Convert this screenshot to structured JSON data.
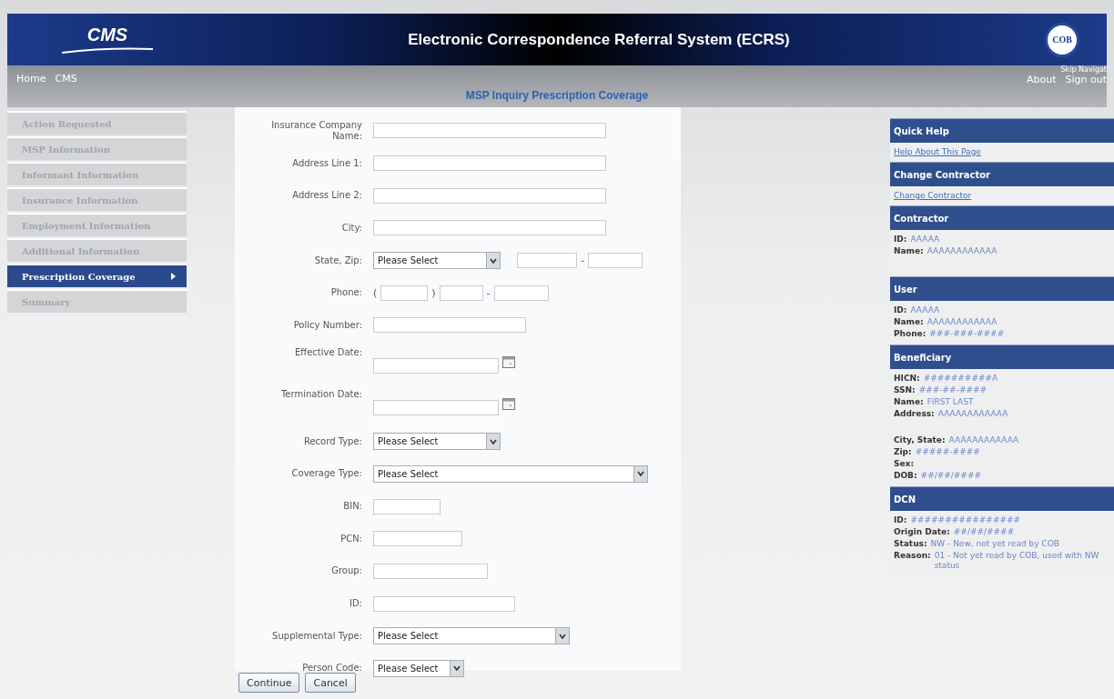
{
  "header": {
    "logo": "CMS",
    "title": "Electronic Correspondence Referral System (ECRS)",
    "badge": "COB"
  },
  "nav": {
    "left": [
      "Home",
      "CMS"
    ],
    "skip": "Skip Navigat",
    "right": [
      "About",
      "Sign out"
    ]
  },
  "page_title": "MSP Inquiry Prescription Coverage",
  "sidebar": {
    "items": [
      {
        "label": "Action Requested",
        "selected": false
      },
      {
        "label": "MSP Information",
        "selected": false
      },
      {
        "label": "Informant Information",
        "selected": false
      },
      {
        "label": "Insurance Information",
        "selected": false
      },
      {
        "label": "Employment Information",
        "selected": false
      },
      {
        "label": "Additional Information",
        "selected": false
      },
      {
        "label": "Prescription Coverage",
        "selected": true
      },
      {
        "label": "Summary",
        "selected": false
      }
    ]
  },
  "form": {
    "rows": [
      {
        "kind": "text",
        "label": "Insurance Company Name:"
      },
      {
        "kind": "text",
        "label": "Address Line 1:"
      },
      {
        "kind": "text",
        "label": "Address Line 2:"
      },
      {
        "kind": "text",
        "label": "City:"
      },
      {
        "kind": "state_zip",
        "label": "State, Zip:",
        "value": "Please Select",
        "separator": "-"
      },
      {
        "kind": "phone",
        "label": "Phone:",
        "open": "(",
        "close": ")",
        "separator": "-"
      },
      {
        "kind": "text",
        "label": "Policy Number:"
      },
      {
        "kind": "date",
        "label": "Effective Date:"
      },
      {
        "kind": "date",
        "label": "Termination Date:"
      },
      {
        "kind": "select",
        "label": "Record Type:",
        "value": "Please Select"
      },
      {
        "kind": "select",
        "label": "Coverage Type:",
        "value": "Please Select"
      },
      {
        "kind": "text",
        "label": "BIN:"
      },
      {
        "kind": "text",
        "label": "PCN:"
      },
      {
        "kind": "text",
        "label": "Group:"
      },
      {
        "kind": "text",
        "label": "ID:"
      },
      {
        "kind": "select",
        "label": "Supplemental Type:",
        "value": "Please Select"
      },
      {
        "kind": "select",
        "label": "Person Code:",
        "value": "Please Select"
      }
    ],
    "buttons": [
      "Continue",
      "Cancel"
    ]
  },
  "panels": [
    {
      "title": "Quick Help",
      "lines": [
        {
          "kind": "link",
          "text": "Help About This Page"
        }
      ]
    },
    {
      "title": "Change Contractor",
      "lines": [
        {
          "kind": "link",
          "text": "Change Contractor"
        }
      ]
    },
    {
      "title": "Contractor",
      "lines": [
        {
          "kind": "field",
          "label": "ID:",
          "value": "AAAAA"
        },
        {
          "kind": "field",
          "label": "Name:",
          "value": "AAAAAAAAAAAA"
        },
        {
          "kind": "gap"
        }
      ]
    },
    {
      "title": "User",
      "lines": [
        {
          "kind": "field",
          "label": "ID:",
          "value": "AAAAA"
        },
        {
          "kind": "field",
          "label": "Name:",
          "value": "AAAAAAAAAAAA"
        },
        {
          "kind": "field",
          "label": "Phone:",
          "value": "###-###-####"
        }
      ]
    },
    {
      "title": "Beneficiary",
      "lines": [
        {
          "kind": "field",
          "label": "HICN:",
          "value": "##########A"
        },
        {
          "kind": "field",
          "label": "SSN:",
          "value": "###-##-####"
        },
        {
          "kind": "field",
          "label": "Name:",
          "value": "FIRST LAST"
        },
        {
          "kind": "field",
          "label": "Address:",
          "value": "AAAAAAAAAAAA"
        },
        {
          "kind": "gap"
        },
        {
          "kind": "field",
          "label": "City, State:",
          "value": "AAAAAAAAAAAA"
        },
        {
          "kind": "field",
          "label": "Zip:",
          "value": "#####-####"
        },
        {
          "kind": "field",
          "label": "Sex:"
        },
        {
          "kind": "field",
          "label": "DOB:",
          "value": "##/##/####"
        }
      ]
    },
    {
      "title": "DCN",
      "lines": [
        {
          "kind": "field",
          "label": "ID:",
          "value": "################"
        },
        {
          "kind": "field",
          "label": "Origin Date:",
          "value": "##/##/####"
        },
        {
          "kind": "field",
          "label": "Status:",
          "value": "NW - New, not yet read by COB"
        },
        {
          "kind": "field",
          "label": "Reason:",
          "value": "01 - Not yet read by COB, used with NW status"
        }
      ]
    }
  ]
}
